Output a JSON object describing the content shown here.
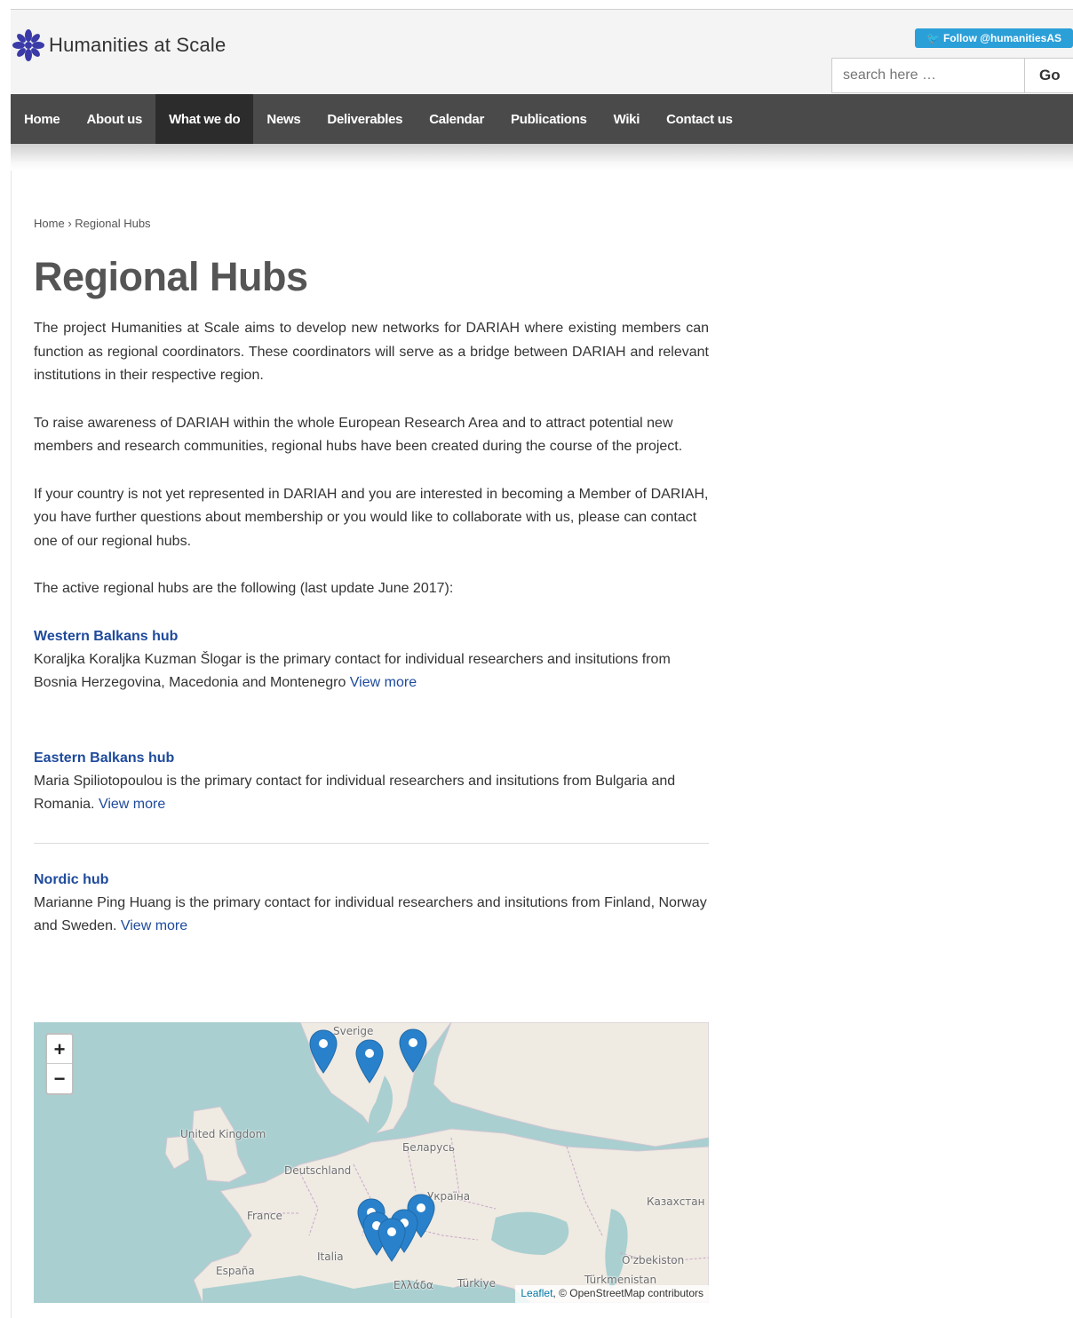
{
  "header": {
    "site_name": "Humanities at Scale",
    "follow_label": "Follow @humanitiesAS",
    "search_placeholder": "search here …",
    "go_label": "Go"
  },
  "nav": {
    "items": [
      {
        "label": "Home"
      },
      {
        "label": "About us"
      },
      {
        "label": "What we do",
        "active": true
      },
      {
        "label": "News"
      },
      {
        "label": "Deliverables"
      },
      {
        "label": "Calendar"
      },
      {
        "label": "Publications"
      },
      {
        "label": "Wiki"
      },
      {
        "label": "Contact us"
      }
    ]
  },
  "breadcrumb": {
    "home": "Home",
    "separator": "›",
    "current": "Regional Hubs"
  },
  "page": {
    "title": "Regional Hubs",
    "intro": [
      "The project Humanities at Scale aims to develop new networks for DARIAH where existing members can function as regional coordinators. These coordinators will serve as a bridge between DARIAH and relevant institutions in their respective region.",
      "To raise awareness of DARIAH within the whole European Research Area and to attract potential new members and research communities, regional hubs have been created during the course of the project.",
      "If your country is not yet represented in DARIAH and you are interested in becoming a Member of DARIAH, you have further questions about membership or you would like to collaborate with us, please can contact one of our regional hubs.",
      "The active regional hubs are the following (last update June 2017):"
    ]
  },
  "hubs": [
    {
      "title": "Western Balkans hub",
      "text": "Koraljka Koraljka Kuzman Šlogar is the primary contact for individual researchers and insitutions from Bosnia Herzegovina, Macedonia and Montenegro",
      "link": "View more"
    },
    {
      "title": "Eastern Balkans hub",
      "text": "Maria Spiliotopoulou is the primary contact for individual researchers and insitutions from Bulgaria and Romania.",
      "link": "View more"
    },
    {
      "title": "Nordic hub",
      "text": "Marianne Ping Huang is the primary contact for individual researchers and insitutions from Finland, Norway and Sweden.",
      "link": "View more"
    }
  ],
  "map": {
    "zoom_in": "+",
    "zoom_out": "−",
    "attribution_leaflet": "Leaflet",
    "attribution_rest": ", © OpenStreetMap contributors",
    "labels": [
      "Sverige",
      "United Kingdom",
      "Беларусь",
      "Deutschland",
      "Україна",
      "France",
      "Казахстан",
      "Italia",
      "España",
      "O'zbekiston",
      "Ελλάδα",
      "Türkiye",
      "Türkmenistan"
    ],
    "marker_color": "#2a81cb"
  },
  "colors": {
    "nav_bg": "#4a4a4a",
    "nav_active": "#2c2c2c",
    "link": "#1e4a9c",
    "twitter": "#2b9fd8",
    "logo": "#3a3aa8"
  }
}
